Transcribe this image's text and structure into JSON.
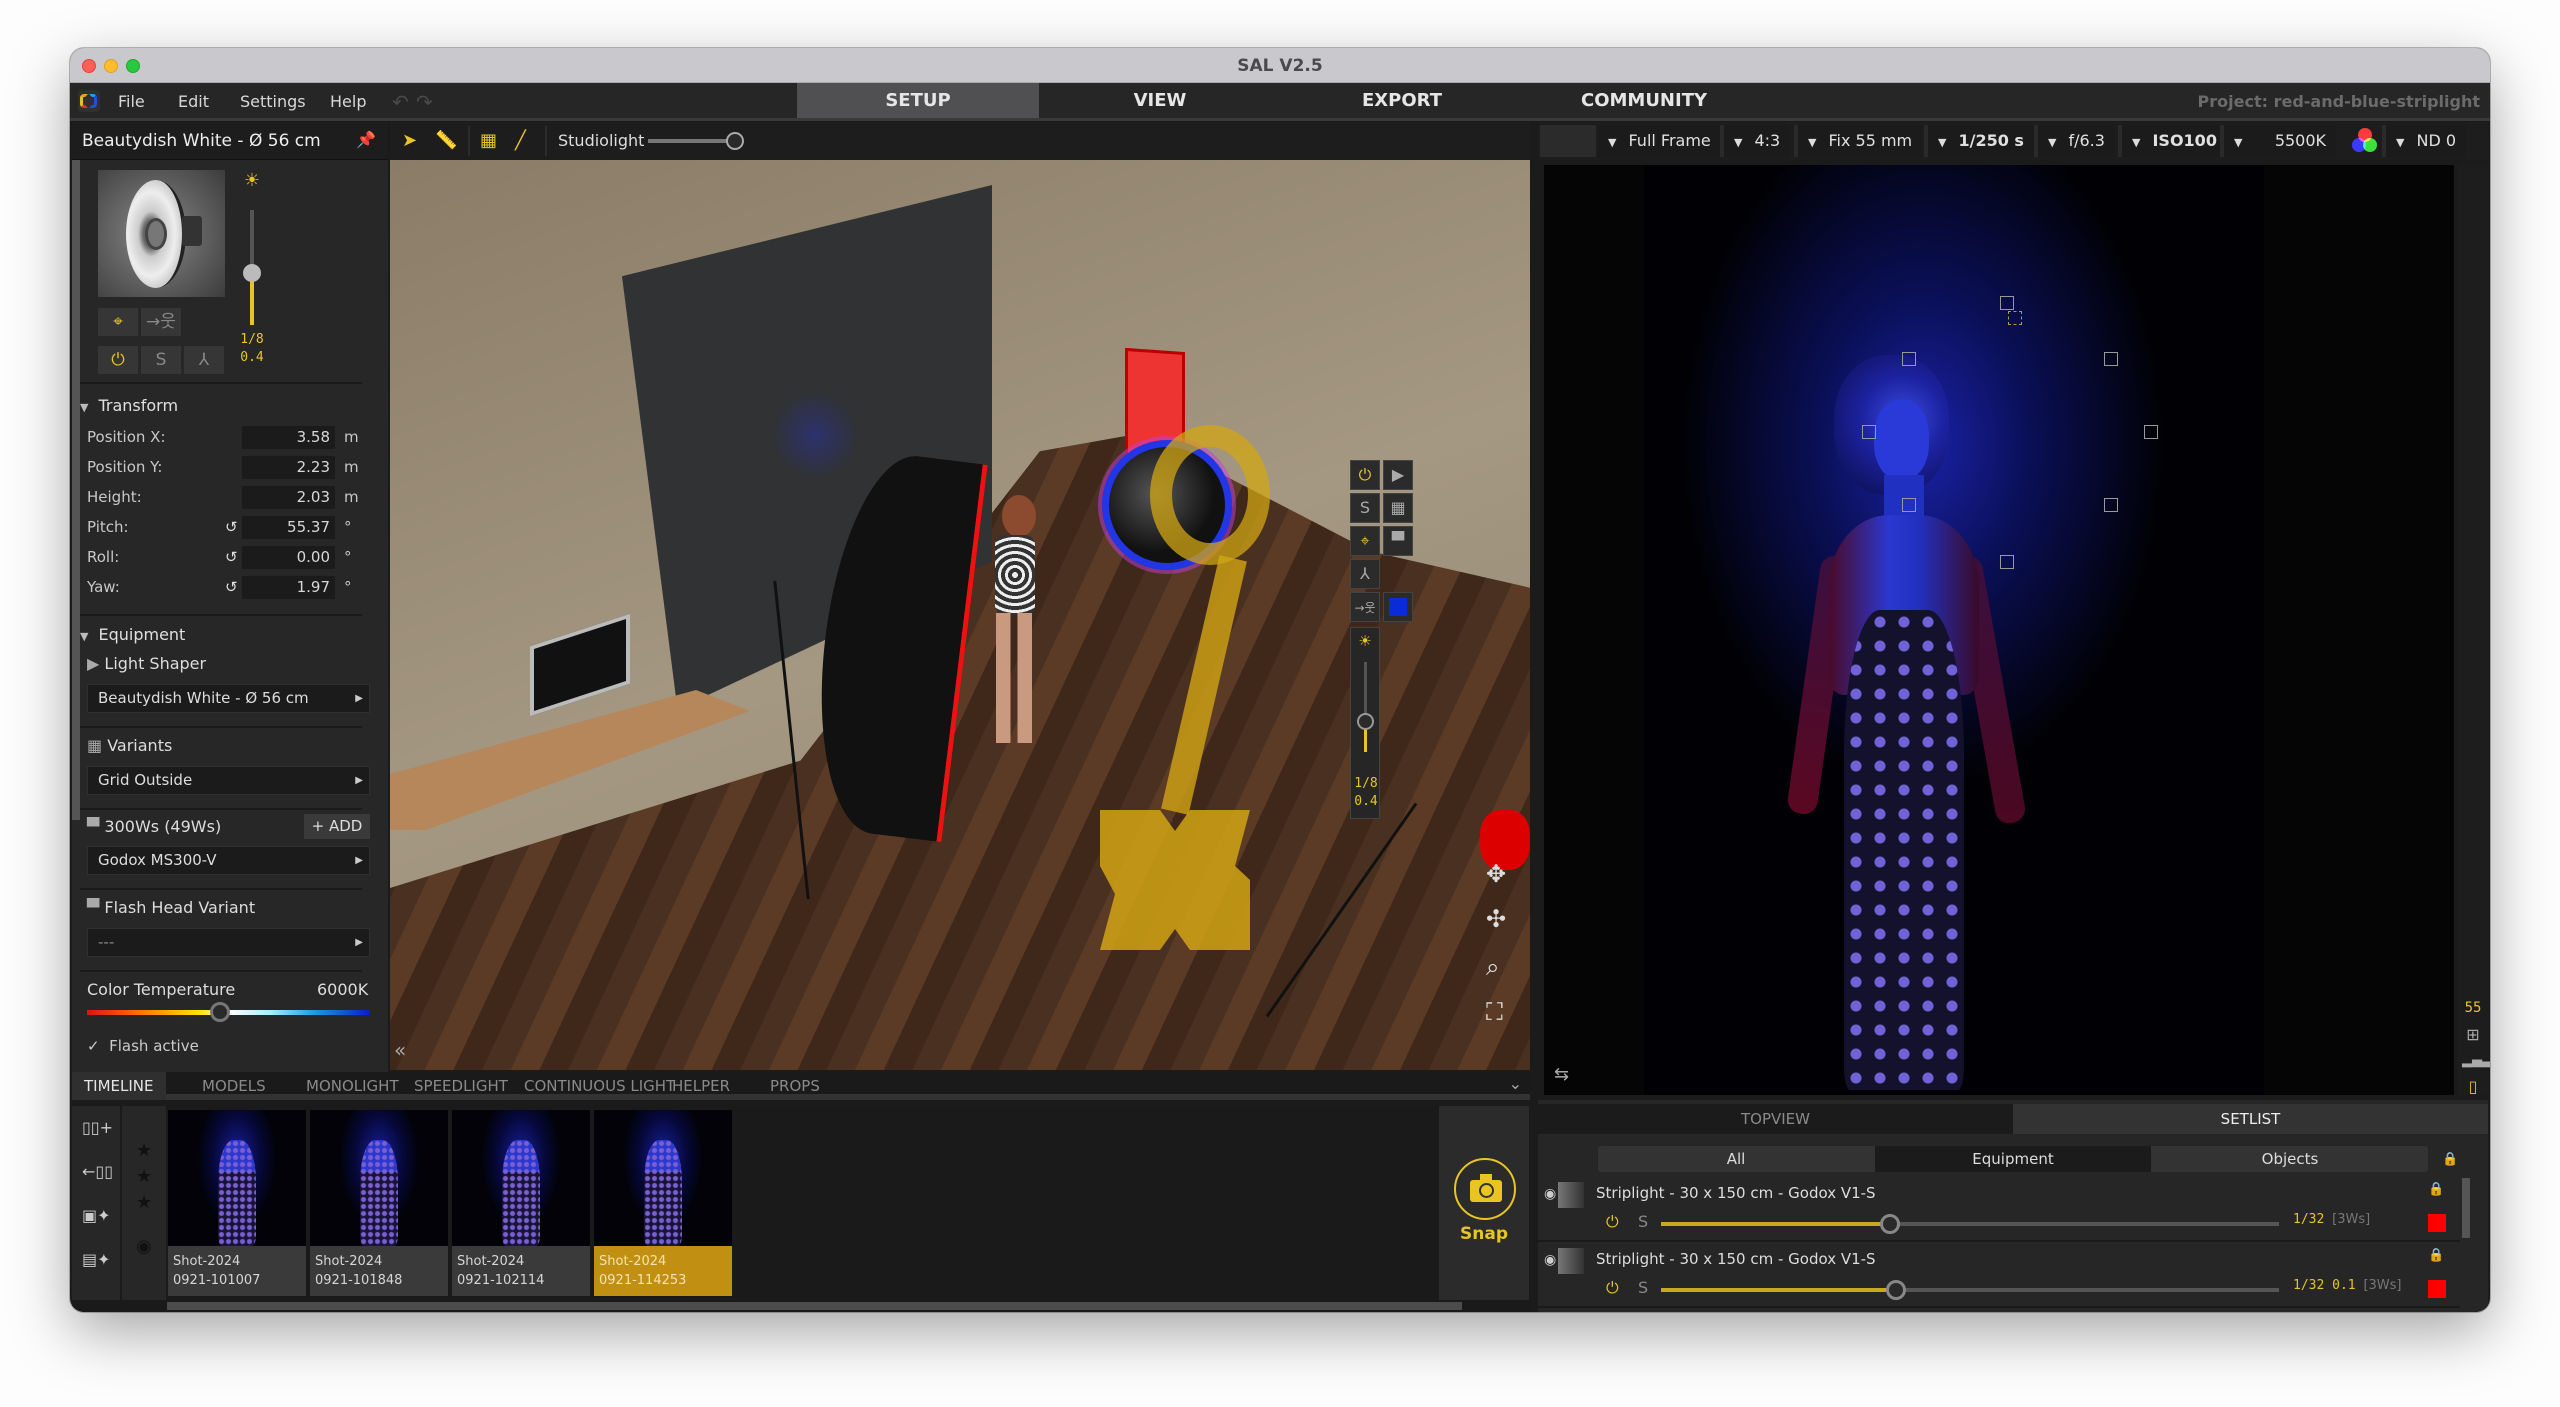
{
  "window": {
    "title": "SAL V2.5"
  },
  "menu": {
    "items": [
      "File",
      "Edit",
      "Settings",
      "Help"
    ],
    "undo_icon": "undo-icon",
    "redo_icon": "redo-icon"
  },
  "main_tabs": [
    {
      "label": "SETUP",
      "active": true
    },
    {
      "label": "VIEW",
      "active": false
    },
    {
      "label": "EXPORT",
      "active": false
    },
    {
      "label": "COMMUNITY",
      "active": false
    }
  ],
  "project": "Project: red-and-blue-striplight",
  "left_panel": {
    "title": "Beautydish White - Ø 56 cm",
    "power": {
      "fraction": "1/8",
      "value": "0.4",
      "level": 0.45
    },
    "transform": {
      "label": "Transform",
      "rows": [
        {
          "label": "Position X:",
          "value": "3.58",
          "unit": "m",
          "resettable": false
        },
        {
          "label": "Position Y:",
          "value": "2.23",
          "unit": "m",
          "resettable": false
        },
        {
          "label": "Height:",
          "value": "2.03",
          "unit": "m",
          "resettable": false
        },
        {
          "label": "Pitch:",
          "value": "55.37",
          "unit": "°",
          "resettable": true
        },
        {
          "label": "Roll:",
          "value": "0.00",
          "unit": "°",
          "resettable": true
        },
        {
          "label": "Yaw:",
          "value": "1.97",
          "unit": "°",
          "resettable": true
        }
      ]
    },
    "equipment": {
      "label": "Equipment",
      "light_shaper_label": "Light Shaper",
      "light_shaper_value": "Beautydish White - Ø 56 cm",
      "variants_label": "Variants",
      "variants_value": "Grid Outside",
      "flash_label": "300Ws (49Ws)",
      "add_label": "ADD",
      "flash_value": "Godox MS300-V",
      "flash_head_label": "Flash Head Variant",
      "flash_head_value": "---",
      "color_temp_label": "Color Temperature",
      "color_temp_value": "6000K",
      "color_temp_level": 0.47,
      "flash_active_label": "Flash active",
      "flash_active": true
    }
  },
  "viewport_toolbar": {
    "studiolight_label": "Studiolight",
    "studiolight_level": 1.0
  },
  "viewport_overlay": {
    "power": {
      "fraction": "1/8",
      "value": "0.4",
      "level": 0.35
    },
    "modifier_color": "#0a2bd6"
  },
  "camera_toolbar": {
    "sensor": "Full Frame",
    "aspect": "4:3",
    "lens": "Fix 55 mm",
    "shutter": "1/250 s",
    "aperture": "f/6.3",
    "iso": "ISO100",
    "white_balance": "5500K",
    "nd": "ND 0"
  },
  "preview": {
    "focal_readout": "55"
  },
  "bottom_tabs": [
    {
      "label": "TIMELINE",
      "active": true
    },
    {
      "label": "MODELS",
      "active": false
    },
    {
      "label": "MONOLIGHT",
      "active": false
    },
    {
      "label": "SPEEDLIGHT",
      "active": false
    },
    {
      "label": "CONTINUOUS LIGHT",
      "active": false
    },
    {
      "label": "HELPER",
      "active": false
    },
    {
      "label": "PROPS",
      "active": false
    }
  ],
  "timeline": {
    "shots": [
      {
        "line1": "Shot-2024",
        "line2": "0921-101007",
        "selected": false
      },
      {
        "line1": "Shot-2024",
        "line2": "0921-101848",
        "selected": false
      },
      {
        "line1": "Shot-2024",
        "line2": "0921-102114",
        "selected": false
      },
      {
        "line1": "Shot-2024",
        "line2": "0921-114253",
        "selected": true
      }
    ],
    "snap_label": "Snap"
  },
  "right_bottom": {
    "tabs": [
      {
        "label": "TOPVIEW",
        "active": false
      },
      {
        "label": "SETLIST",
        "active": true
      }
    ],
    "filters": [
      {
        "label": "All",
        "active": false
      },
      {
        "label": "Equipment",
        "active": true
      },
      {
        "label": "Objects",
        "active": false
      }
    ],
    "items": [
      {
        "name": "Striplight - 30 x 150 cm - Godox V1-S",
        "power": "1/32",
        "extra": "",
        "ws": "[3Ws]",
        "level": 0.37,
        "color": "#ff0000"
      },
      {
        "name": "Striplight - 30 x 150 cm - Godox V1-S",
        "power": "1/32",
        "extra": "0.1",
        "ws": "[3Ws]",
        "level": 0.38,
        "color": "#ff0000"
      }
    ]
  }
}
